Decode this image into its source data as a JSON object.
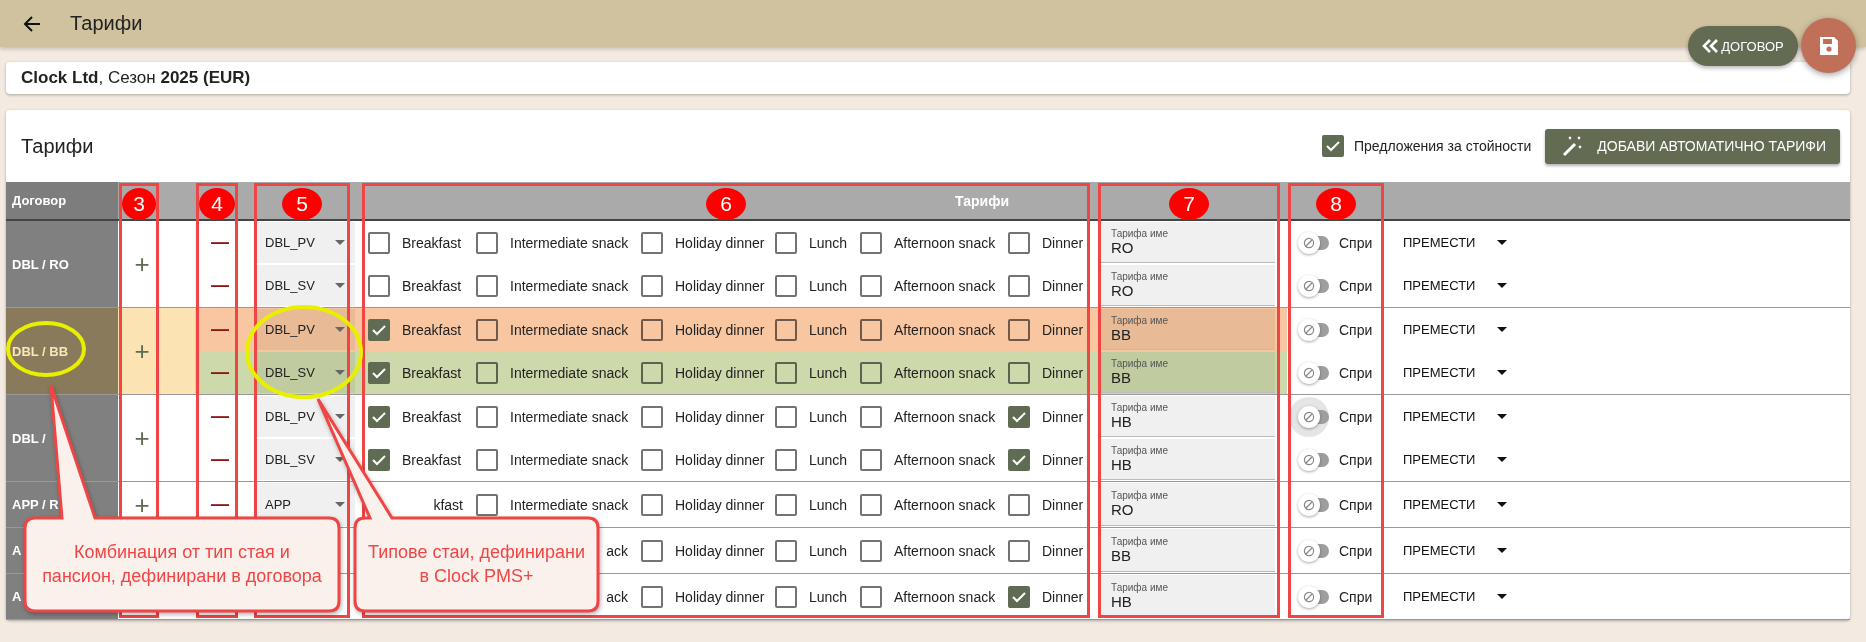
{
  "top_bar": {
    "title": "Тарифи",
    "contract_button": "ДОГОВОР"
  },
  "summary": "**Clock Ltd**, Сезон **2025 (EUR)**",
  "panel": {
    "title": "Тарифи",
    "suggestions": {
      "label": "Предложения за стойности",
      "checked": true
    },
    "auto_button": "ДОБАВИ АВТОМАТИЧНО ТАРИФИ"
  },
  "table": {
    "columns": [
      "Договор",
      "Тарифи"
    ],
    "groups": [
      {
        "contract": "DBL / RO",
        "selected": false,
        "plus": "+",
        "rows": [
          {
            "minus": "—",
            "room": "DBL_PV",
            "meals": [
              {
                "kind": "full",
                "label": "Breakfast",
                "checked": false
              },
              {
                "kind": "full",
                "label": "Intermediate snack",
                "checked": false
              },
              {
                "kind": "full",
                "label": "Holiday dinner",
                "checked": false
              },
              {
                "kind": "full",
                "label": "Lunch",
                "checked": false
              },
              {
                "kind": "full",
                "label": "Afternoon snack",
                "checked": false
              },
              {
                "kind": "full",
                "label": "Dinner",
                "checked": false
              }
            ],
            "rate_label": "Тарифа име",
            "rate": "RO",
            "stop_label": "Спри",
            "stop_on": false,
            "focused": false,
            "move": "ПРЕМЕСТИ"
          },
          {
            "minus": "—",
            "room": "DBL_SV",
            "meals": [
              {
                "kind": "full",
                "label": "Breakfast",
                "checked": false
              },
              {
                "kind": "full",
                "label": "Intermediate snack",
                "checked": false
              },
              {
                "kind": "full",
                "label": "Holiday dinner",
                "checked": false
              },
              {
                "kind": "full",
                "label": "Lunch",
                "checked": false
              },
              {
                "kind": "full",
                "label": "Afternoon snack",
                "checked": false
              },
              {
                "kind": "full",
                "label": "Dinner",
                "checked": false
              }
            ],
            "rate_label": "Тарифа име",
            "rate": "RO",
            "stop_label": "Спри",
            "stop_on": false,
            "focused": false,
            "move": "ПРЕМЕСТИ"
          }
        ]
      },
      {
        "contract": "DBL / BB",
        "selected": true,
        "plus": "+",
        "rows": [
          {
            "color": "#f8c6a0",
            "minus": "—",
            "room": "DBL_PV",
            "meals": [
              {
                "kind": "full",
                "label": "Breakfast",
                "checked": true
              },
              {
                "kind": "full",
                "label": "Intermediate snack",
                "checked": false
              },
              {
                "kind": "full",
                "label": "Holiday dinner",
                "checked": false
              },
              {
                "kind": "full",
                "label": "Lunch",
                "checked": false
              },
              {
                "kind": "full",
                "label": "Afternoon snack",
                "checked": false
              },
              {
                "kind": "full",
                "label": "Dinner",
                "checked": false
              }
            ],
            "rate_label": "Тарифа име",
            "rate": "BB",
            "stop_label": "Спри",
            "stop_on": false,
            "focused": false,
            "move": "ПРЕМЕСТИ"
          },
          {
            "color": "#cdd9aa",
            "minus": "—",
            "room": "DBL_SV",
            "meals": [
              {
                "kind": "full",
                "label": "Breakfast",
                "checked": true
              },
              {
                "kind": "full",
                "label": "Intermediate snack",
                "checked": false
              },
              {
                "kind": "full",
                "label": "Holiday dinner",
                "checked": false
              },
              {
                "kind": "full",
                "label": "Lunch",
                "checked": false
              },
              {
                "kind": "full",
                "label": "Afternoon snack",
                "checked": false
              },
              {
                "kind": "full",
                "label": "Dinner",
                "checked": false
              }
            ],
            "rate_label": "Тарифа име",
            "rate": "BB",
            "stop_label": "Спри",
            "stop_on": false,
            "focused": false,
            "move": "ПРЕМЕСТИ"
          }
        ]
      },
      {
        "contract": "DBL /",
        "selected": false,
        "plus": "+",
        "rows": [
          {
            "minus": "—",
            "room": "DBL_PV",
            "meals": [
              {
                "kind": "full",
                "label": "Breakfast",
                "checked": true
              },
              {
                "kind": "full",
                "label": "Intermediate snack",
                "checked": false
              },
              {
                "kind": "full",
                "label": "Holiday dinner",
                "checked": false
              },
              {
                "kind": "full",
                "label": "Lunch",
                "checked": false
              },
              {
                "kind": "full",
                "label": "Afternoon snack",
                "checked": false
              },
              {
                "kind": "full",
                "label": "Dinner",
                "checked": true
              }
            ],
            "rate_label": "Тарифа име",
            "rate": "HB",
            "stop_label": "Спри",
            "stop_on": false,
            "focused": true,
            "move": "ПРЕМЕСТИ"
          },
          {
            "minus": "—",
            "room": "DBL_SV",
            "meals": [
              {
                "kind": "full",
                "label": "Breakfast",
                "checked": true
              },
              {
                "kind": "full",
                "label": "Intermediate snack",
                "checked": false
              },
              {
                "kind": "full",
                "label": "Holiday dinner",
                "checked": false
              },
              {
                "kind": "full",
                "label": "Lunch",
                "checked": false
              },
              {
                "kind": "full",
                "label": "Afternoon snack",
                "checked": false
              },
              {
                "kind": "full",
                "label": "Dinner",
                "checked": true
              }
            ],
            "rate_label": "Тарифа име",
            "rate": "HB",
            "stop_label": "Спри",
            "stop_on": false,
            "focused": false,
            "move": "ПРЕМЕСТИ"
          }
        ]
      },
      {
        "contract": "APP / R",
        "selected": false,
        "plus": "+",
        "rows": [
          {
            "minus": "—",
            "room": "APP",
            "meals": [
              {
                "kind": "tail",
                "label": "kfast"
              },
              {
                "kind": "full",
                "label": "Intermediate snack",
                "checked": false
              },
              {
                "kind": "full",
                "label": "Holiday dinner",
                "checked": false
              },
              {
                "kind": "full",
                "label": "Lunch",
                "checked": false
              },
              {
                "kind": "full",
                "label": "Afternoon snack",
                "checked": false
              },
              {
                "kind": "full",
                "label": "Dinner",
                "checked": false
              }
            ],
            "rate_label": "Тарифа име",
            "rate": "RO",
            "stop_label": "Спри",
            "stop_on": false,
            "focused": false,
            "move": "ПРЕМЕСТИ"
          }
        ]
      },
      {
        "contract": "A",
        "selected": false,
        "rows": [
          {
            "meals": [
              {
                "kind": "covered"
              },
              {
                "kind": "tail",
                "label": "ack"
              },
              {
                "kind": "full",
                "label": "Holiday dinner",
                "checked": false
              },
              {
                "kind": "full",
                "label": "Lunch",
                "checked": false
              },
              {
                "kind": "full",
                "label": "Afternoon snack",
                "checked": false
              },
              {
                "kind": "full",
                "label": "Dinner",
                "checked": false
              }
            ],
            "rate_label": "Тарифа име",
            "rate": "BB",
            "stop_label": "Спри",
            "stop_on": false,
            "focused": false,
            "move": "ПРЕМЕСТИ"
          }
        ]
      },
      {
        "contract": "A",
        "selected": false,
        "rows": [
          {
            "meals": [
              {
                "kind": "covered"
              },
              {
                "kind": "tail",
                "label": "ack"
              },
              {
                "kind": "full",
                "label": "Holiday dinner",
                "checked": false
              },
              {
                "kind": "full",
                "label": "Lunch",
                "checked": false
              },
              {
                "kind": "full",
                "label": "Afternoon snack",
                "checked": false
              },
              {
                "kind": "full",
                "label": "Dinner",
                "checked": true
              }
            ],
            "rate_label": "Тарифа име",
            "rate": "HB",
            "stop_label": "Спри",
            "stop_on": false,
            "focused": false,
            "move": "ПРЕМЕСТИ"
          }
        ]
      }
    ]
  },
  "annotations": {
    "markers": [
      "3",
      "4",
      "5",
      "6",
      "7",
      "8"
    ],
    "callouts": [
      "Комбинация от тип стая и пансион, дефинирани в договора",
      "Типове стаи, дефинирани в Clock PMS+"
    ]
  }
}
